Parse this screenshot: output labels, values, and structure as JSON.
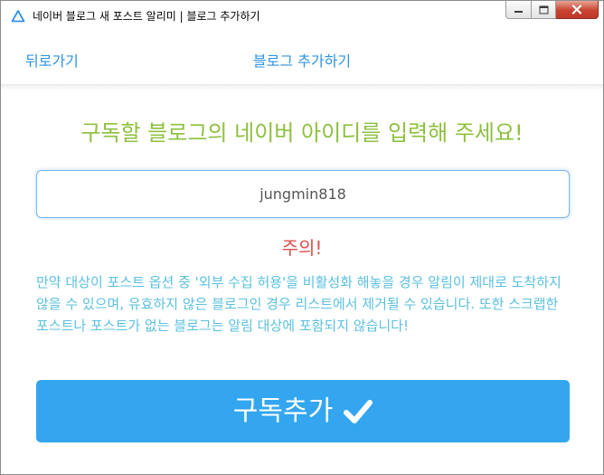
{
  "window": {
    "title": "네이버 블로그 새 포스트 알리미 | 블로그 추가하기",
    "app_icon": "triangle-icon",
    "controls": [
      "minimize-icon",
      "maximize-icon",
      "close-icon"
    ]
  },
  "nav": {
    "back_label": "뒤로가기",
    "title": "블로그 추가하기"
  },
  "main": {
    "heading": "구독할 블로그의 네이버 아이디를 입력해 주세요!",
    "input_value": "jungmin818",
    "warning_title": "주의!",
    "warning_body": "만약 대상이 포스트 옵션 중 '외부 수집 허용'을 비활성화 해놓을 경우 알림이 제대로 도착하지 않을 수 있으며, 유효하지 않은 블로그인 경우 리스트에서 제거될 수 있습니다. 또한 스크랩한 포스트나 포스트가 없는 블로그는 알림 대상에 포함되지 않습니다!",
    "submit_label": "구독추가",
    "submit_icon": "check-icon"
  },
  "colors": {
    "accent_blue": "#33a6ef",
    "link_blue": "#2f93e4",
    "heading_green": "#8dc03f",
    "warning_red": "#d9534f",
    "info_cyan": "#5bc0de"
  }
}
